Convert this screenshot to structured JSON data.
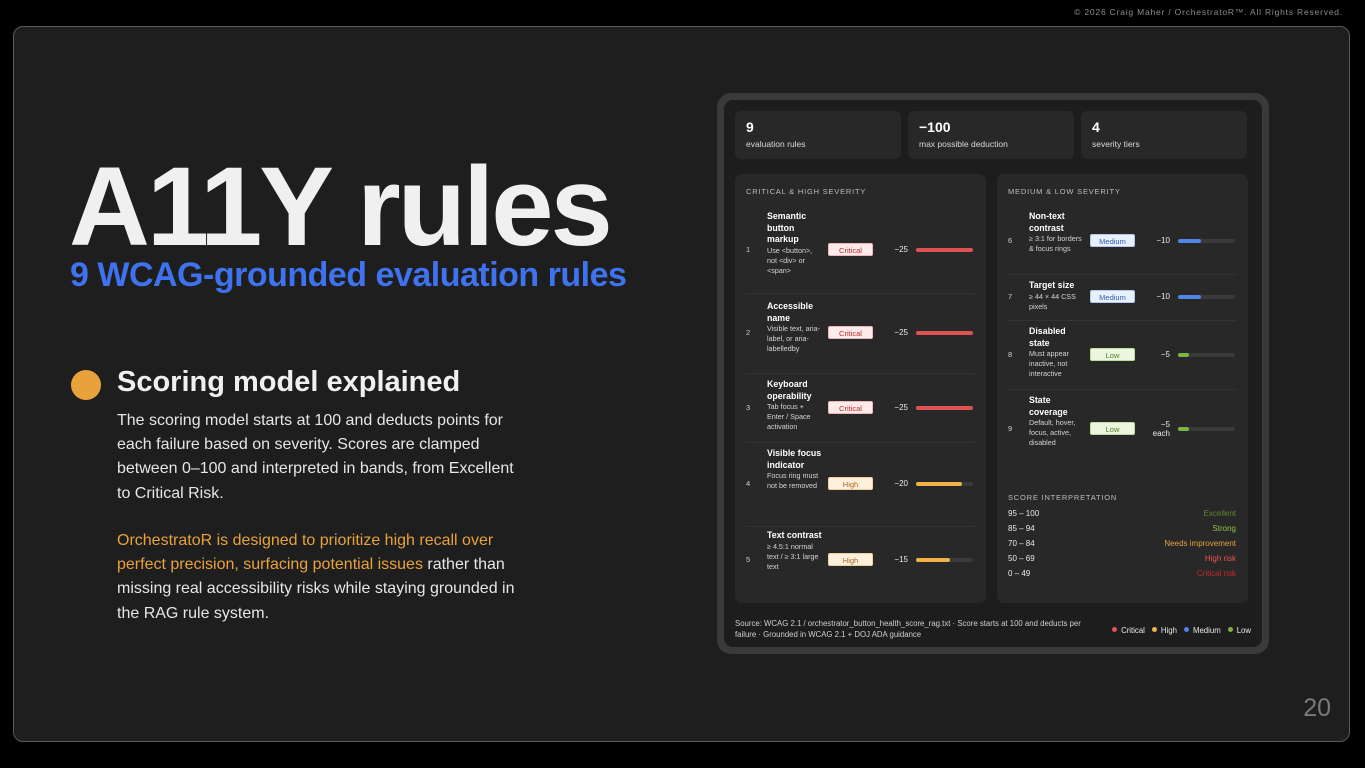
{
  "copyright": "© 2026 Craig Maher / OrchestratoR™. All Rights Reserved.",
  "title": "A11Y rules",
  "subtitle": "9 WCAG-grounded evaluation rules",
  "section": {
    "heading": "Scoring model explained",
    "para1": "The scoring model starts at 100 and deducts points for each failure based on severity. Scores are clamped between 0–100 and interpreted in bands, from Excellent to Critical Risk.",
    "para2_highlight": "OrchestratoR is designed to prioritize high recall over perfect precision, surfacing potential issues",
    "para2_rest": " rather than missing real accessibility risks while staying grounded in the RAG rule system."
  },
  "page_number": "20",
  "colors": {
    "accent_blue": "#3f72ee",
    "accent_orange": "#e8a23c",
    "critical": "#e05252",
    "high": "#f1b24a",
    "medium": "#4f86e8",
    "low": "#7cb342"
  },
  "stats": [
    {
      "value": "9",
      "label": "evaluation rules"
    },
    {
      "value": "−100",
      "label": "max possible deduction"
    },
    {
      "value": "4",
      "label": "severity tiers"
    }
  ],
  "critical_panel": {
    "heading": "CRITICAL & HIGH SEVERITY",
    "rules": [
      {
        "num": "1",
        "title": "Semantic button markup",
        "desc": "Use <button>, not <div> or <span>",
        "severity": "Critical",
        "deduction": "−25",
        "bar_fraction": 1.0
      },
      {
        "num": "2",
        "title": "Accessible name",
        "desc": "Visible text, aria-label, or aria-labelledby",
        "severity": "Critical",
        "deduction": "−25",
        "bar_fraction": 1.0
      },
      {
        "num": "3",
        "title": "Keyboard operability",
        "desc": "Tab focus + Enter / Space activation",
        "severity": "Critical",
        "deduction": "−25",
        "bar_fraction": 1.0
      },
      {
        "num": "4",
        "title": "Visible focus indicator",
        "desc": "Focus ring must not be removed",
        "severity": "High",
        "deduction": "−20",
        "bar_fraction": 0.8
      },
      {
        "num": "5",
        "title": "Text contrast",
        "desc": "≥ 4.5:1 normal text / ≥ 3:1 large text",
        "severity": "High",
        "deduction": "−15",
        "bar_fraction": 0.6
      }
    ]
  },
  "medium_panel": {
    "heading": "MEDIUM & LOW SEVERITY",
    "rules": [
      {
        "num": "6",
        "title": "Non-text contrast",
        "desc": "≥ 3:1 for borders & focus rings",
        "severity": "Medium",
        "deduction": "−10",
        "bar_fraction": 0.4
      },
      {
        "num": "7",
        "title": "Target size",
        "desc": "≥ 44 × 44 CSS pixels",
        "severity": "Medium",
        "deduction": "−10",
        "bar_fraction": 0.4
      },
      {
        "num": "8",
        "title": "Disabled state",
        "desc": "Must appear inactive, not interactive",
        "severity": "Low",
        "deduction": "−5",
        "bar_fraction": 0.2
      },
      {
        "num": "9",
        "title": "State coverage",
        "desc": "Default, hover, focus, active, disabled",
        "severity": "Low",
        "deduction": "−5",
        "deduction_sub": "each",
        "bar_fraction": 0.2
      }
    ],
    "interpretation_heading": "SCORE INTERPRETATION",
    "bands": [
      {
        "range": "95 – 100",
        "label": "Excellent",
        "color": "#5a8a2a"
      },
      {
        "range": "85 – 94",
        "label": "Strong",
        "color": "#8bc34a"
      },
      {
        "range": "70 – 84",
        "label": "Needs improvement",
        "color": "#e8a23c"
      },
      {
        "range": "50 – 69",
        "label": "High risk",
        "color": "#ef5350"
      },
      {
        "range": "0 – 49",
        "label": "Critical risk",
        "color": "#c62828"
      }
    ]
  },
  "footer": {
    "source": "Source: WCAG 2.1 / orchestrator_button_health_score_rag.txt · Score starts at 100 and deducts per failure · Grounded in WCAG 2.1 + DOJ ADA guidance",
    "legend": [
      "Critical",
      "High",
      "Medium",
      "Low"
    ]
  }
}
